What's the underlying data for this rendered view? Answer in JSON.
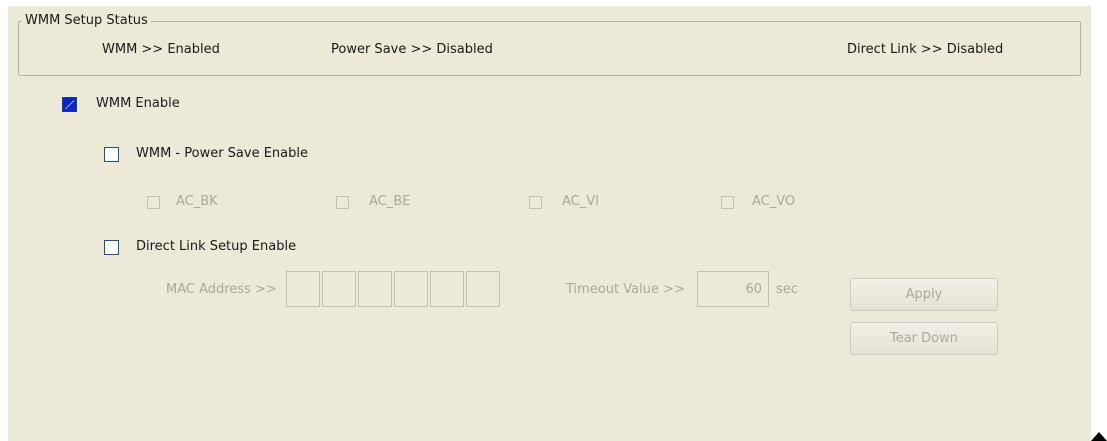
{
  "status_group": {
    "title": "WMM Setup Status",
    "wmm": "WMM >> Enabled",
    "power_save": "Power Save >> Disabled",
    "direct_link": "Direct Link >> Disabled"
  },
  "wmm_enable": {
    "label": "WMM Enable",
    "checked": true
  },
  "power_save_enable": {
    "label": "WMM - Power Save Enable",
    "checked": false
  },
  "access_categories": [
    {
      "label": "AC_BK",
      "checked": false,
      "enabled": false
    },
    {
      "label": "AC_BE",
      "checked": false,
      "enabled": false
    },
    {
      "label": "AC_VI",
      "checked": false,
      "enabled": false
    },
    {
      "label": "AC_VO",
      "checked": false,
      "enabled": false
    }
  ],
  "direct_link_enable": {
    "label": "Direct Link Setup Enable",
    "checked": false
  },
  "direct_link": {
    "mac_label": "MAC Address >>",
    "mac_segments": [
      "",
      "",
      "",
      "",
      "",
      ""
    ],
    "timeout_label": "Timeout Value >>",
    "timeout_value": "60",
    "timeout_unit": "sec",
    "apply_label": "Apply",
    "teardown_label": "Tear Down"
  },
  "colors": {
    "panel_bg": "#ece9d8",
    "disabled_text": "#aca899",
    "checked_fill": "#0a24c8"
  }
}
